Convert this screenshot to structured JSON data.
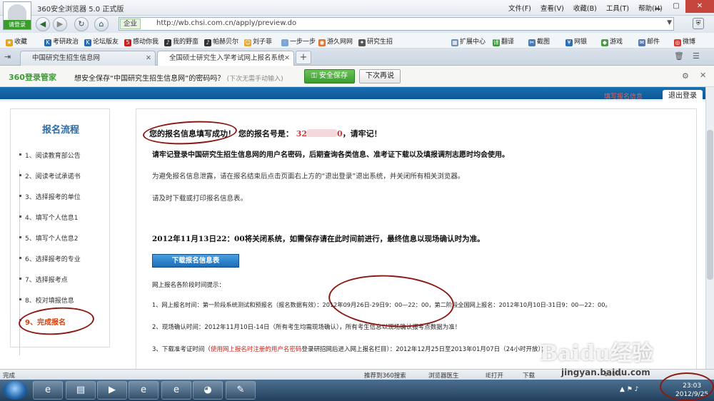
{
  "window": {
    "title": "360安全浏览器 5.0 正式版",
    "login": "请登录",
    "menu": [
      "文件(F)",
      "查看(V)",
      "收藏(B)",
      "工具(T)",
      "帮助(H)"
    ]
  },
  "address": {
    "zone": "企业",
    "url": "http://wb.chsi.com.cn/apply/preview.do"
  },
  "favorites": [
    "收藏",
    "考研政治",
    "论坛版友",
    "感动你我",
    "我的野蛮",
    "帕赫贝尔",
    "刘子菲",
    "一步一步",
    "游久网网",
    "研究生招"
  ],
  "favorites_right": [
    "扩展中心",
    "翻译",
    "截图",
    "网银",
    "游戏",
    "邮件",
    "微博"
  ],
  "tabs": [
    {
      "label": "中国研究生招生信息网",
      "active": false
    },
    {
      "label": "全国硕士研究生入学考试网上报名系统",
      "active": true
    }
  ],
  "password_bar": {
    "brand": "360登录管家",
    "text": "想安全保存“中国研究生招生信息网”的密码吗？",
    "hint": "(下次无需手动输入)",
    "save": "安全保存",
    "later": "下次再说"
  },
  "page": {
    "fill_info": "填写报名信息",
    "logout": "退出登录",
    "sidebar_title": "报名流程",
    "steps": [
      "1、阅读教育部公告",
      "2、阅读考试承诺书",
      "3、选择报考的单位",
      "4、填写个人信息1",
      "5、填写个人信息2",
      "6、选择报考的专业",
      "7、选择报考点",
      "8、校对填报信息",
      "9、完成报名"
    ],
    "success_a": "您的报名信息填写成功！",
    "success_b": "您的报名号是：",
    "reg_no_visible": "32",
    "reg_no_tail": "0",
    "success_c": "，请牢记！",
    "remember": "请牢记登录中国研究生招生信息网的用户名密码，后期查询各类信息、准考证下载以及填报调剂志愿时均会使用。",
    "privacy": "为避免报名信息泄露，请在报名结束后点击页面右上方的“退出登录”退出系统，并关闭所有相关浏览器。",
    "download_hint": "请及时下载或打印报名信息表。",
    "close_notice": "2012年11月13日22：00将关闭系统，如需保存请在此时间前进行，最终信息以现场确认时为准。",
    "download_btn": "下载报名信息表",
    "schedule_title": "网上报名各阶段时间提示：",
    "schedule_1": "1、网上报名时间：第一阶段系统测试和预报名（报名数据有效）：2012年09月26日-29日9：00—22：00，第二阶段全国网上报名：2012年10月10日-31日9：00—22：00。",
    "schedule_2": "2、现场确认时间：2012年11月10日-14日（所有考生均需现场确认），所有考生信息以现场确认报考点数据为准！",
    "schedule_3a": "3、下载准考证时间（",
    "schedule_3red": "使用网上报名时注册的用户名密码",
    "schedule_3b": "登录研招网后进入网上报名栏目）：2012年12月25日至2013年01月07日（24小时开放）；"
  },
  "status": {
    "text": "完成",
    "items": [
      "推荐到360搜索",
      "浏览器医生",
      "IE打开",
      "下载",
      "100%"
    ]
  },
  "taskbar": {
    "time": "23:03",
    "date": "2012/9/25"
  },
  "watermark": {
    "brand": "Baidu经验",
    "url": "jingyan.baidu.com"
  }
}
